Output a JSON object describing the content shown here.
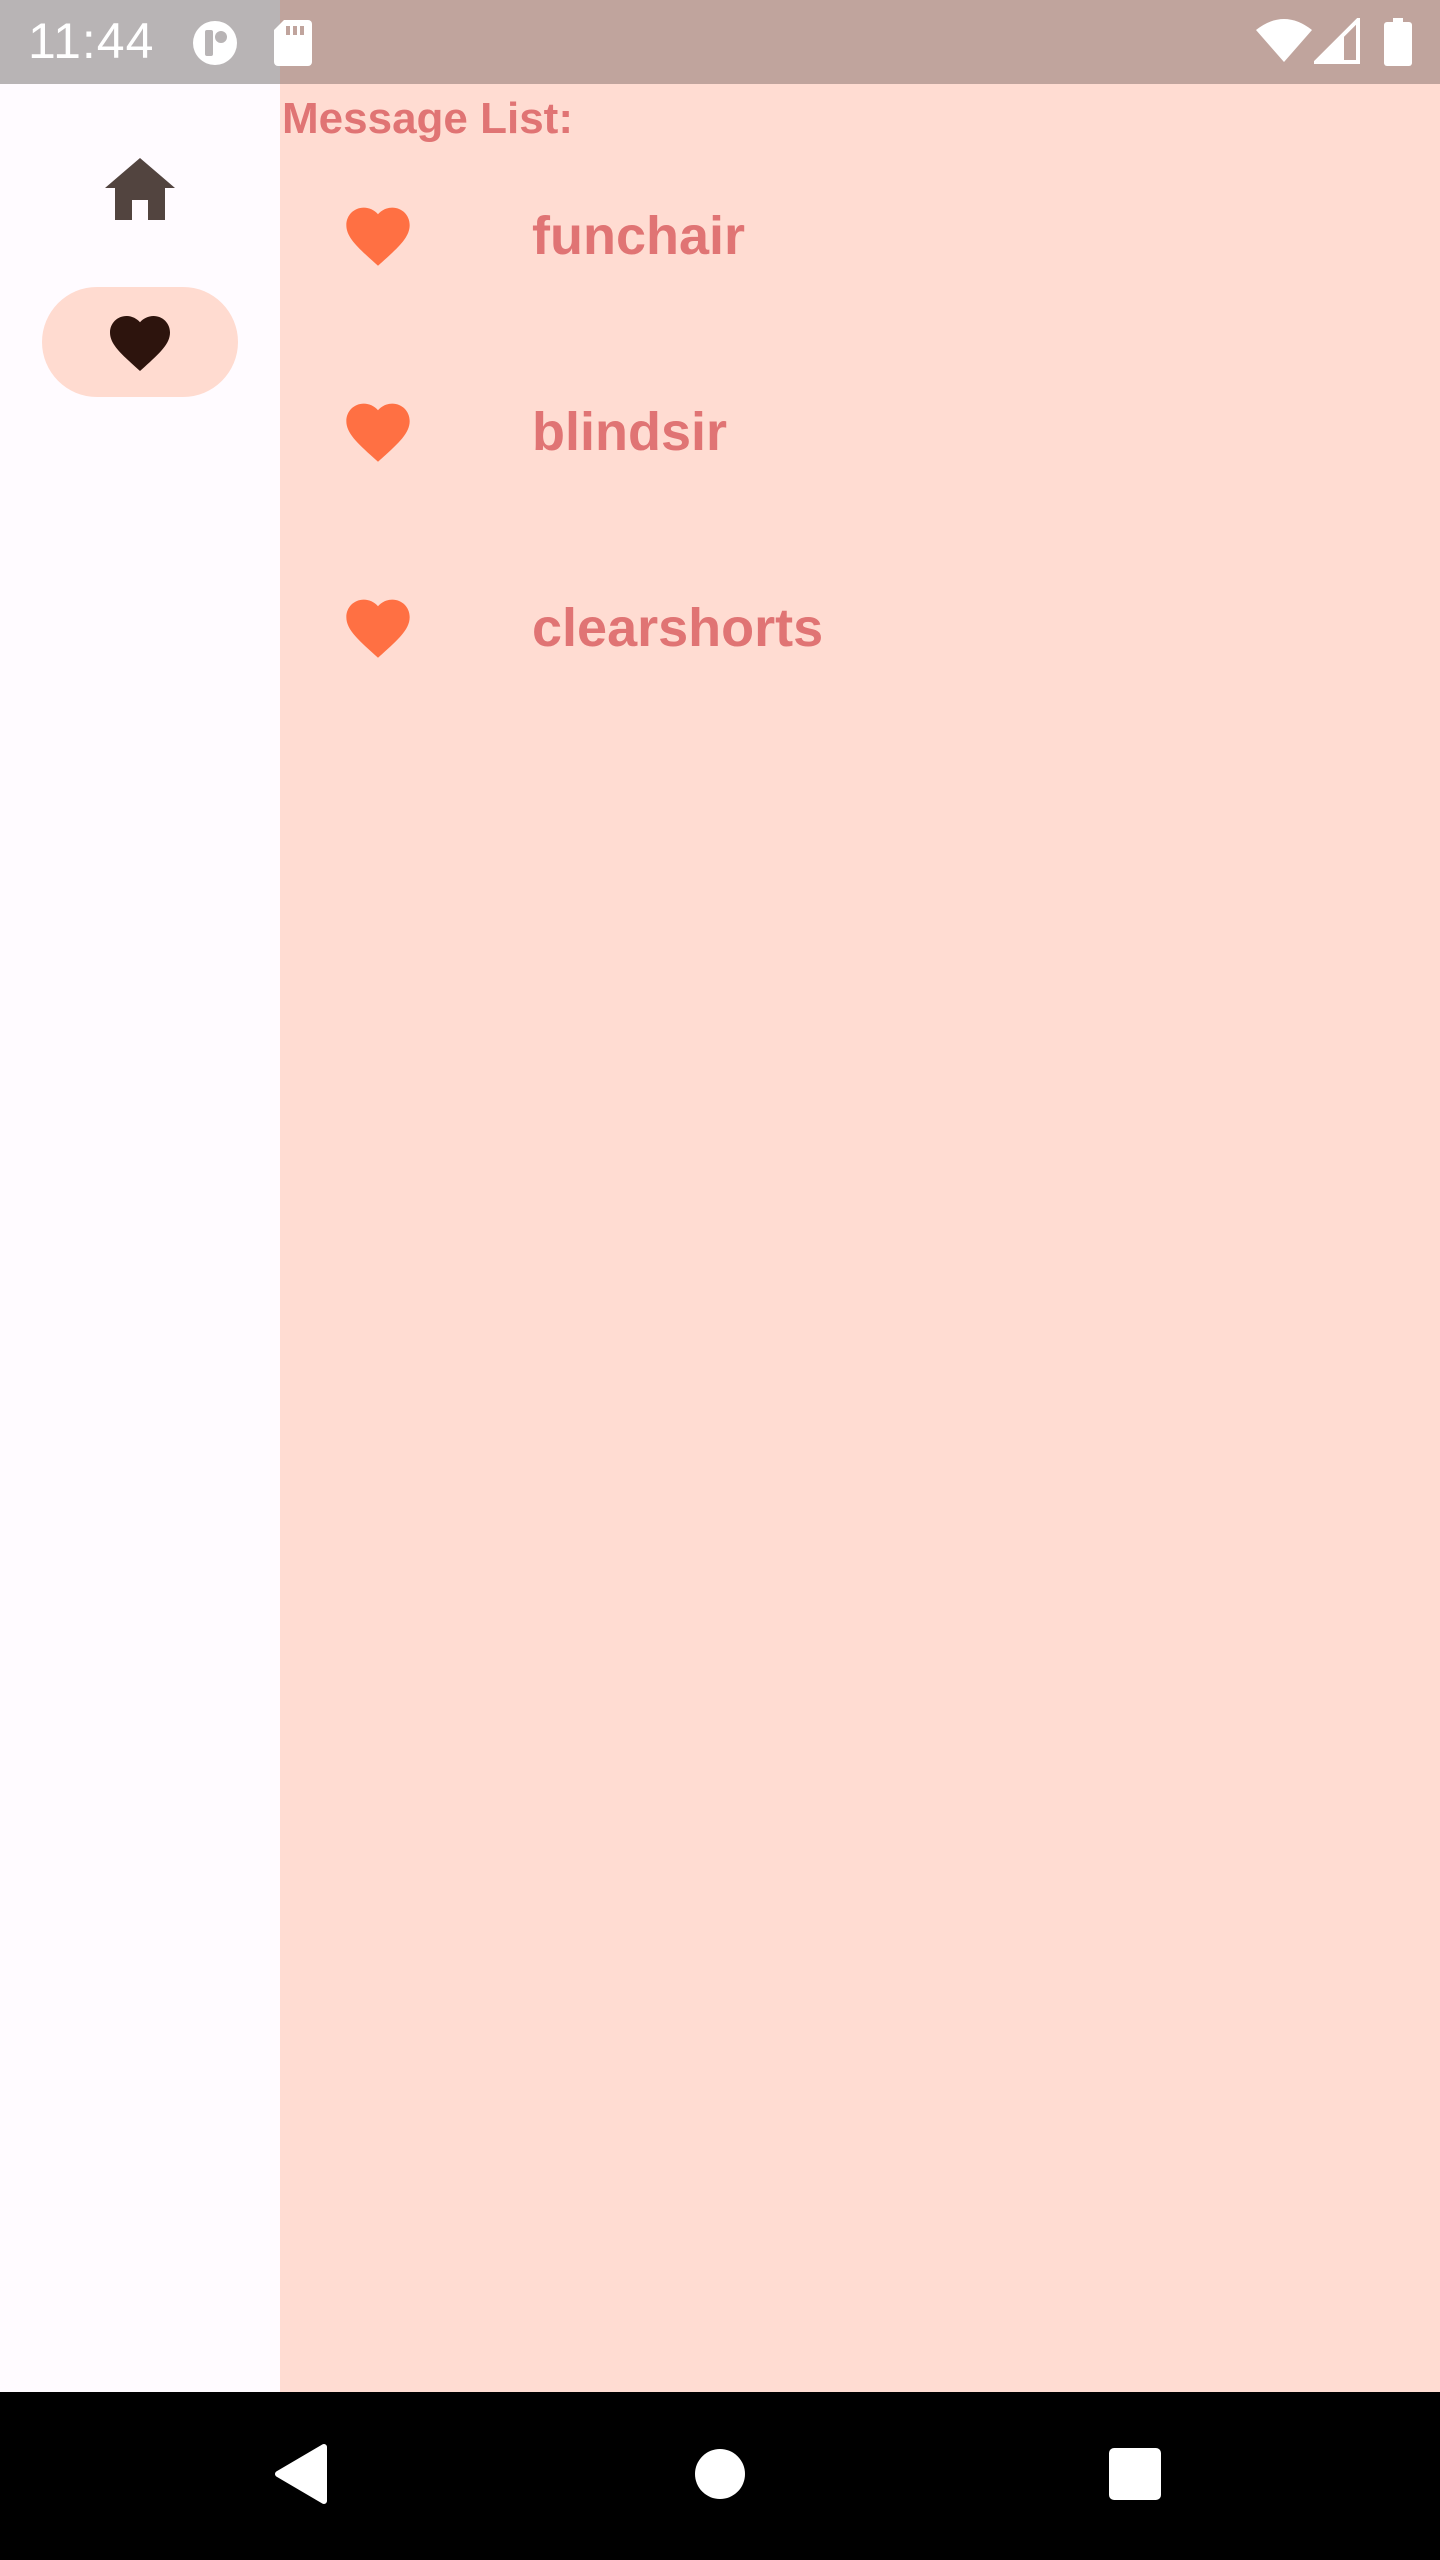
{
  "status_bar": {
    "time": "11:44",
    "icons": [
      "app-notification-icon",
      "sd-card-icon",
      "wifi-icon",
      "signal-icon",
      "battery-icon"
    ]
  },
  "nav_rail": {
    "items": [
      {
        "id": "home",
        "icon": "home-icon",
        "selected": false
      },
      {
        "id": "favorites",
        "icon": "heart-icon",
        "selected": true
      }
    ]
  },
  "main": {
    "title": "Message List:",
    "messages": [
      {
        "name": "funchair",
        "icon": "heart-icon"
      },
      {
        "name": "blindsir",
        "icon": "heart-icon"
      },
      {
        "name": "clearshorts",
        "icon": "heart-icon"
      }
    ]
  },
  "system_nav": {
    "buttons": [
      "back-icon",
      "home-circle-icon",
      "recents-icon"
    ]
  },
  "colors": {
    "accent_text": "#e07474",
    "heart": "#ff7043",
    "content_bg": "#ffdcd2",
    "selected_pill": "#ffdbd0",
    "rail_bg": "#fffbff"
  }
}
